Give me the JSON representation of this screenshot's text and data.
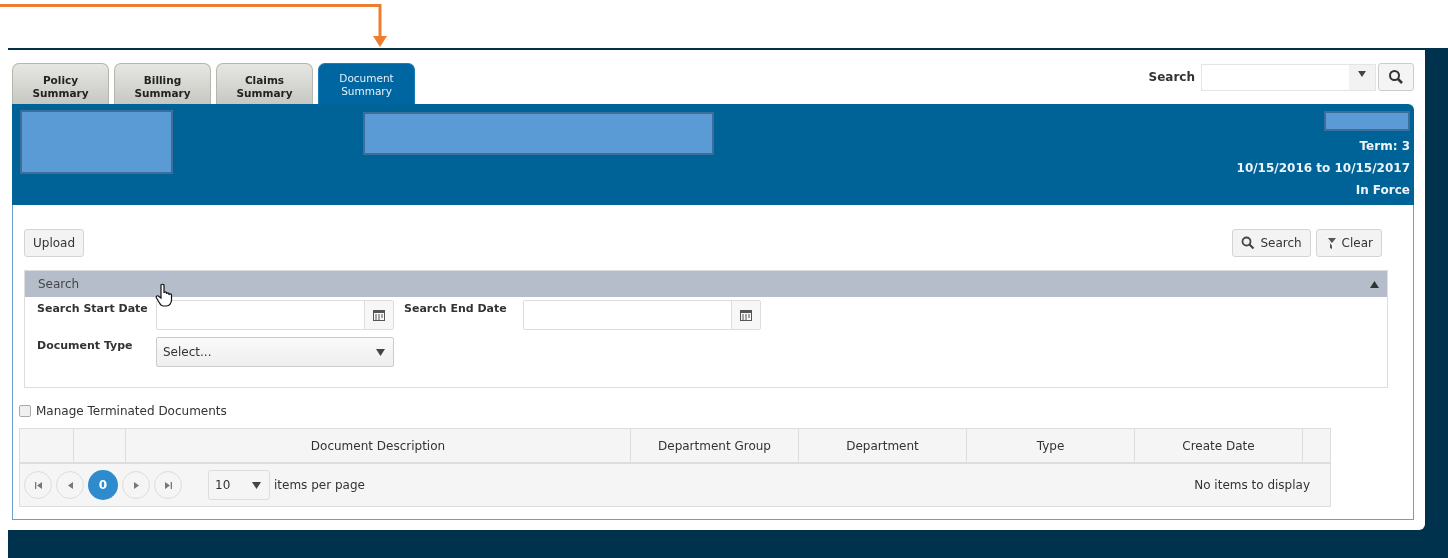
{
  "tabs": [
    {
      "label": "Policy\nSummary",
      "selected": false
    },
    {
      "label": "Billing\nSummary",
      "selected": false
    },
    {
      "label": "Claims\nSummary",
      "selected": false
    },
    {
      "label": "Document\nSummary",
      "selected": true
    }
  ],
  "global_search": {
    "label": "Search"
  },
  "header": {
    "term": "Term: 3",
    "period": "10/15/2016 to 10/15/2017",
    "status": "In Force"
  },
  "toolbar": {
    "upload": "Upload",
    "search": "Search",
    "clear": "Clear"
  },
  "search_panel": {
    "title": "Search",
    "expanded": true,
    "fields": [
      {
        "label": "Search Start Date",
        "kind": "date"
      },
      {
        "label": "Search End Date",
        "kind": "date"
      },
      {
        "label": "Document Type",
        "kind": "select",
        "value": "Select..."
      }
    ]
  },
  "manage_terminated": {
    "label": "Manage Terminated Documents",
    "checked": false
  },
  "table": {
    "columns": [
      "",
      "",
      "Document Description",
      "Department Group",
      "Department",
      "Type",
      "Create Date",
      ""
    ]
  },
  "pager": {
    "page": "0",
    "page_size": "10",
    "page_size_label": "items per page",
    "status": "No items to display"
  }
}
